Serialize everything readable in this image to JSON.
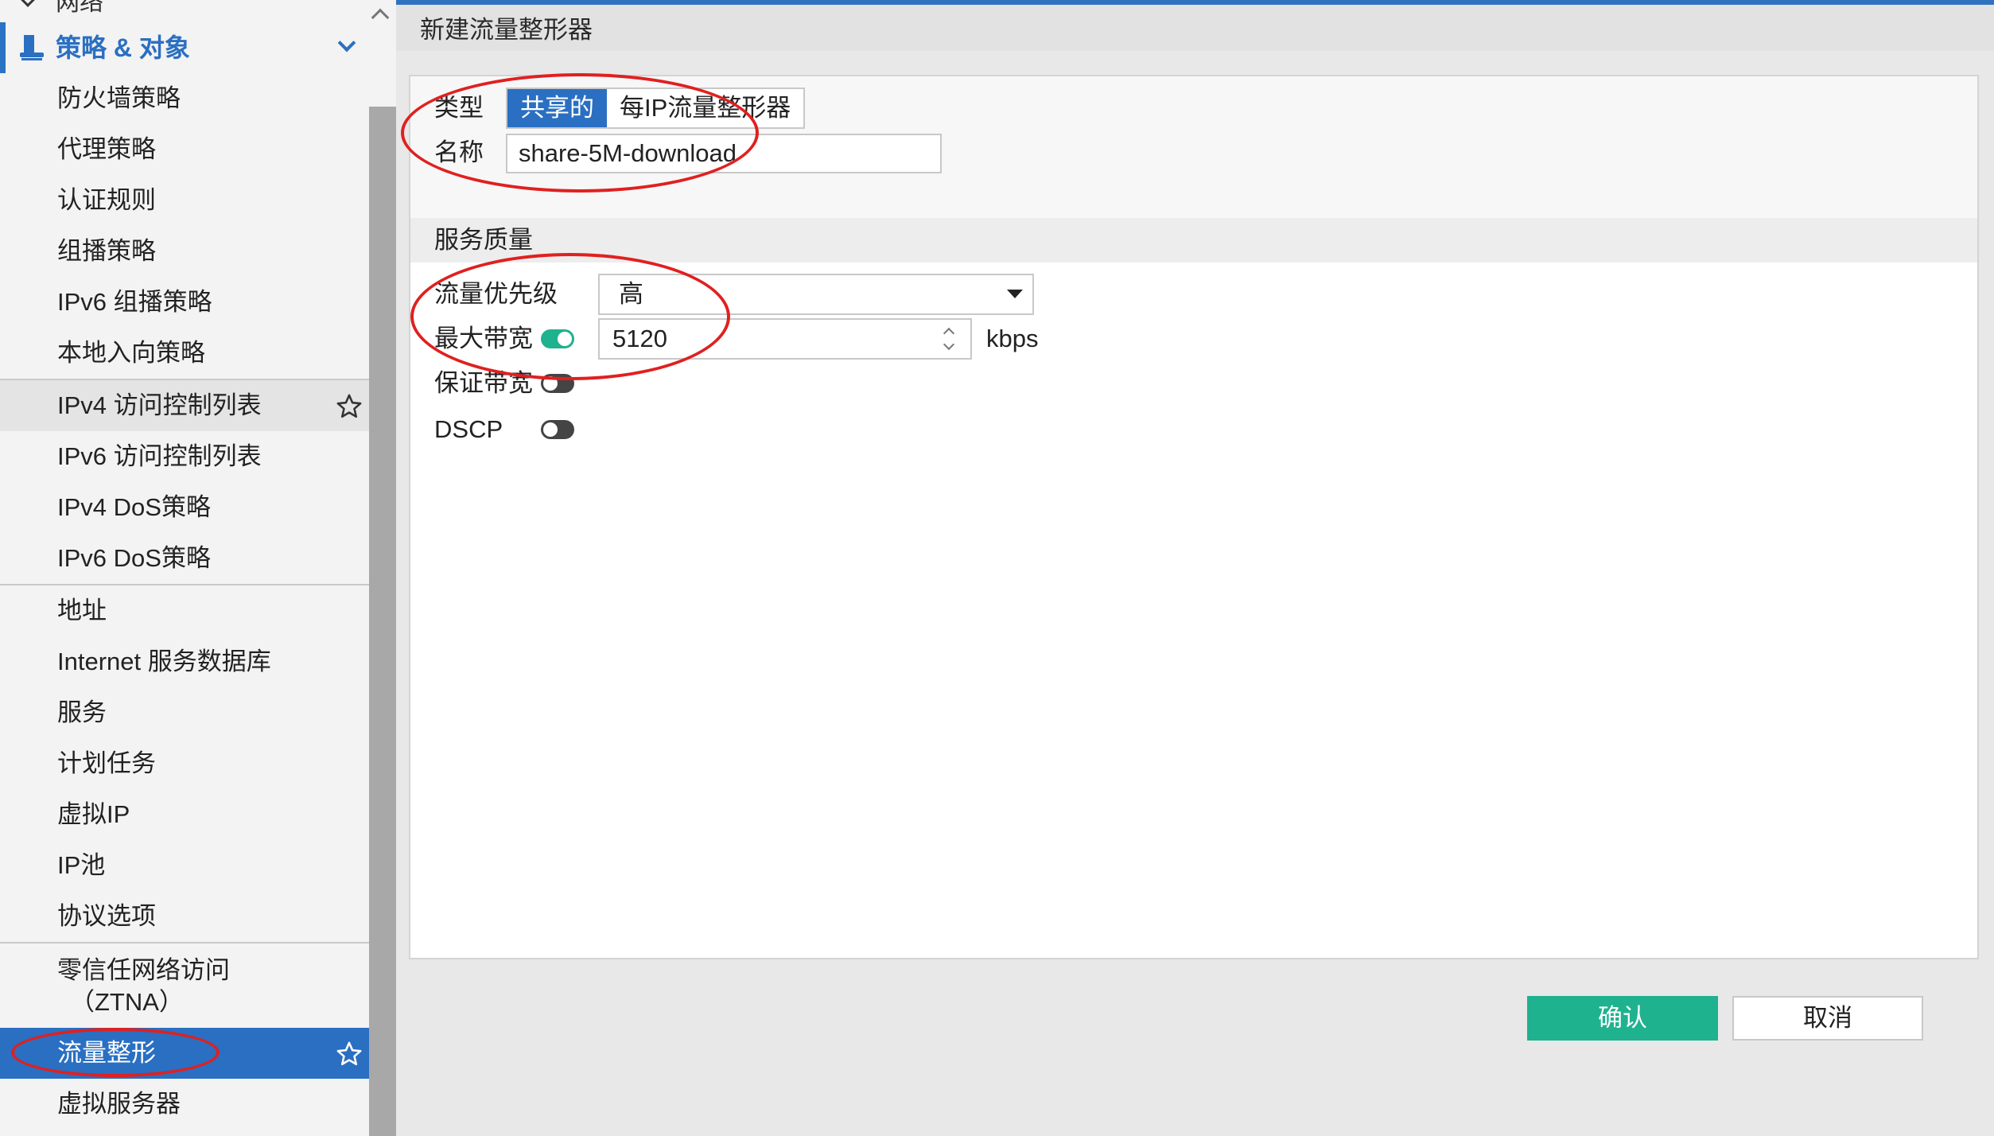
{
  "sidebar": {
    "top_cut_label": "网络",
    "section_title": "策略 & 对象",
    "items": [
      {
        "label": "防火墙策略"
      },
      {
        "label": "代理策略"
      },
      {
        "label": "认证规则"
      },
      {
        "label": "组播策略"
      },
      {
        "label": "IPv6 组播策略"
      },
      {
        "label": "本地入向策略"
      },
      {
        "label": "IPv4 访问控制列表"
      },
      {
        "label": "IPv6 访问控制列表"
      },
      {
        "label": "IPv4 DoS策略"
      },
      {
        "label": "IPv6 DoS策略"
      },
      {
        "label": "地址"
      },
      {
        "label": "Internet 服务数据库"
      },
      {
        "label": "服务"
      },
      {
        "label": "计划任务"
      },
      {
        "label": "虚拟IP"
      },
      {
        "label": "IP池"
      },
      {
        "label": "协议选项"
      },
      {
        "label": "零信任网络访问",
        "label2": "（ZTNA）"
      },
      {
        "label": "流量整形"
      },
      {
        "label": "虚拟服务器"
      }
    ]
  },
  "page": {
    "title": "新建流量整形器"
  },
  "form": {
    "type_label": "类型",
    "type_options": [
      "共享的",
      "每IP流量整形器"
    ],
    "name_label": "名称",
    "name_value": "share-5M-download",
    "qos_section": "服务质量",
    "priority_label": "流量优先级",
    "priority_value": "高",
    "max_bw_label": "最大带宽",
    "max_bw_value": "5120",
    "max_bw_unit": "kbps",
    "guaranteed_bw_label": "保证带宽",
    "dscp_label": "DSCP"
  },
  "buttons": {
    "ok": "确认",
    "cancel": "取消"
  },
  "colors": {
    "accent": "#2a6fc2",
    "toggle_on": "#1fb28f",
    "annotation": "#e02020"
  }
}
